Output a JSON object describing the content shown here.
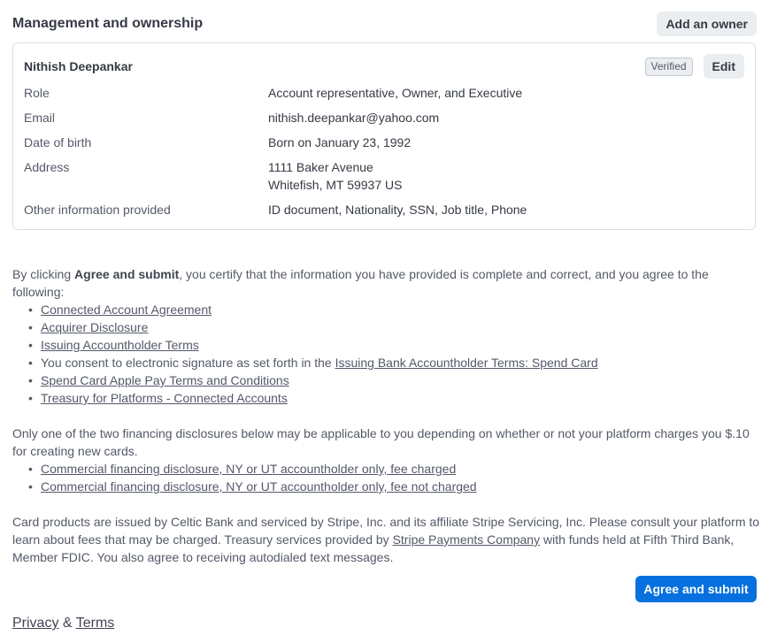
{
  "section": {
    "title": "Management and ownership",
    "add_owner_label": "Add an owner"
  },
  "owner": {
    "name": "Nithish Deepankar",
    "verified_label": "Verified",
    "edit_label": "Edit",
    "rows": {
      "role": {
        "label": "Role",
        "value": "Account representative, Owner, and Executive"
      },
      "email": {
        "label": "Email",
        "value": "nithish.deepankar@yahoo.com"
      },
      "dob": {
        "label": "Date of birth",
        "value": "Born on January 23, 1992"
      },
      "address": {
        "label": "Address",
        "line1": "1111 Baker Avenue",
        "line2": "Whitefish, MT 59937 US"
      },
      "other": {
        "label": "Other information provided",
        "value": "ID document, Nationality, SSN, Job title, Phone"
      }
    }
  },
  "legal": {
    "intro_pre": "By clicking ",
    "intro_bold": "Agree and submit",
    "intro_post": ", you certify that the information you have provided is complete and correct, and you agree to the following:",
    "links": {
      "connected": "Connected Account Agreement",
      "acquirer": "Acquirer Disclosure",
      "issuing": "Issuing Accountholder Terms",
      "consent_text": "You consent to electronic signature as set forth in the ",
      "spend_card_terms": "Issuing Bank Accountholder Terms: Spend Card",
      "apple_pay": "Spend Card Apple Pay Terms and Conditions",
      "treasury": "Treasury for Platforms - Connected Accounts"
    },
    "financing_text": "Only one of the two financing disclosures below may be applicable to you depending on whether or not your platform charges you $.10 for creating new cards.",
    "financing_links": {
      "fee_charged": "Commercial financing disclosure, NY or UT accountholder only, fee charged",
      "fee_not_charged": "Commercial financing disclosure, NY or UT accountholder only, fee not charged"
    },
    "card_text_pre": "Card products are issued by Celtic Bank and serviced by Stripe, Inc. and its affiliate Stripe Servicing, Inc. Please consult your platform to learn about fees that may be charged. Treasury services provided by ",
    "card_link": "Stripe Payments Company",
    "card_text_post": " with funds held at Fifth Third Bank, Member FDIC. You also agree to receiving autodialed text messages."
  },
  "submit_label": "Agree and submit",
  "footer": {
    "privacy": "Privacy",
    "amp": " & ",
    "terms": "Terms"
  },
  "colors": {
    "primary": "#0570de",
    "secondary_bg": "#ebeef1",
    "border": "#d8dee4"
  }
}
